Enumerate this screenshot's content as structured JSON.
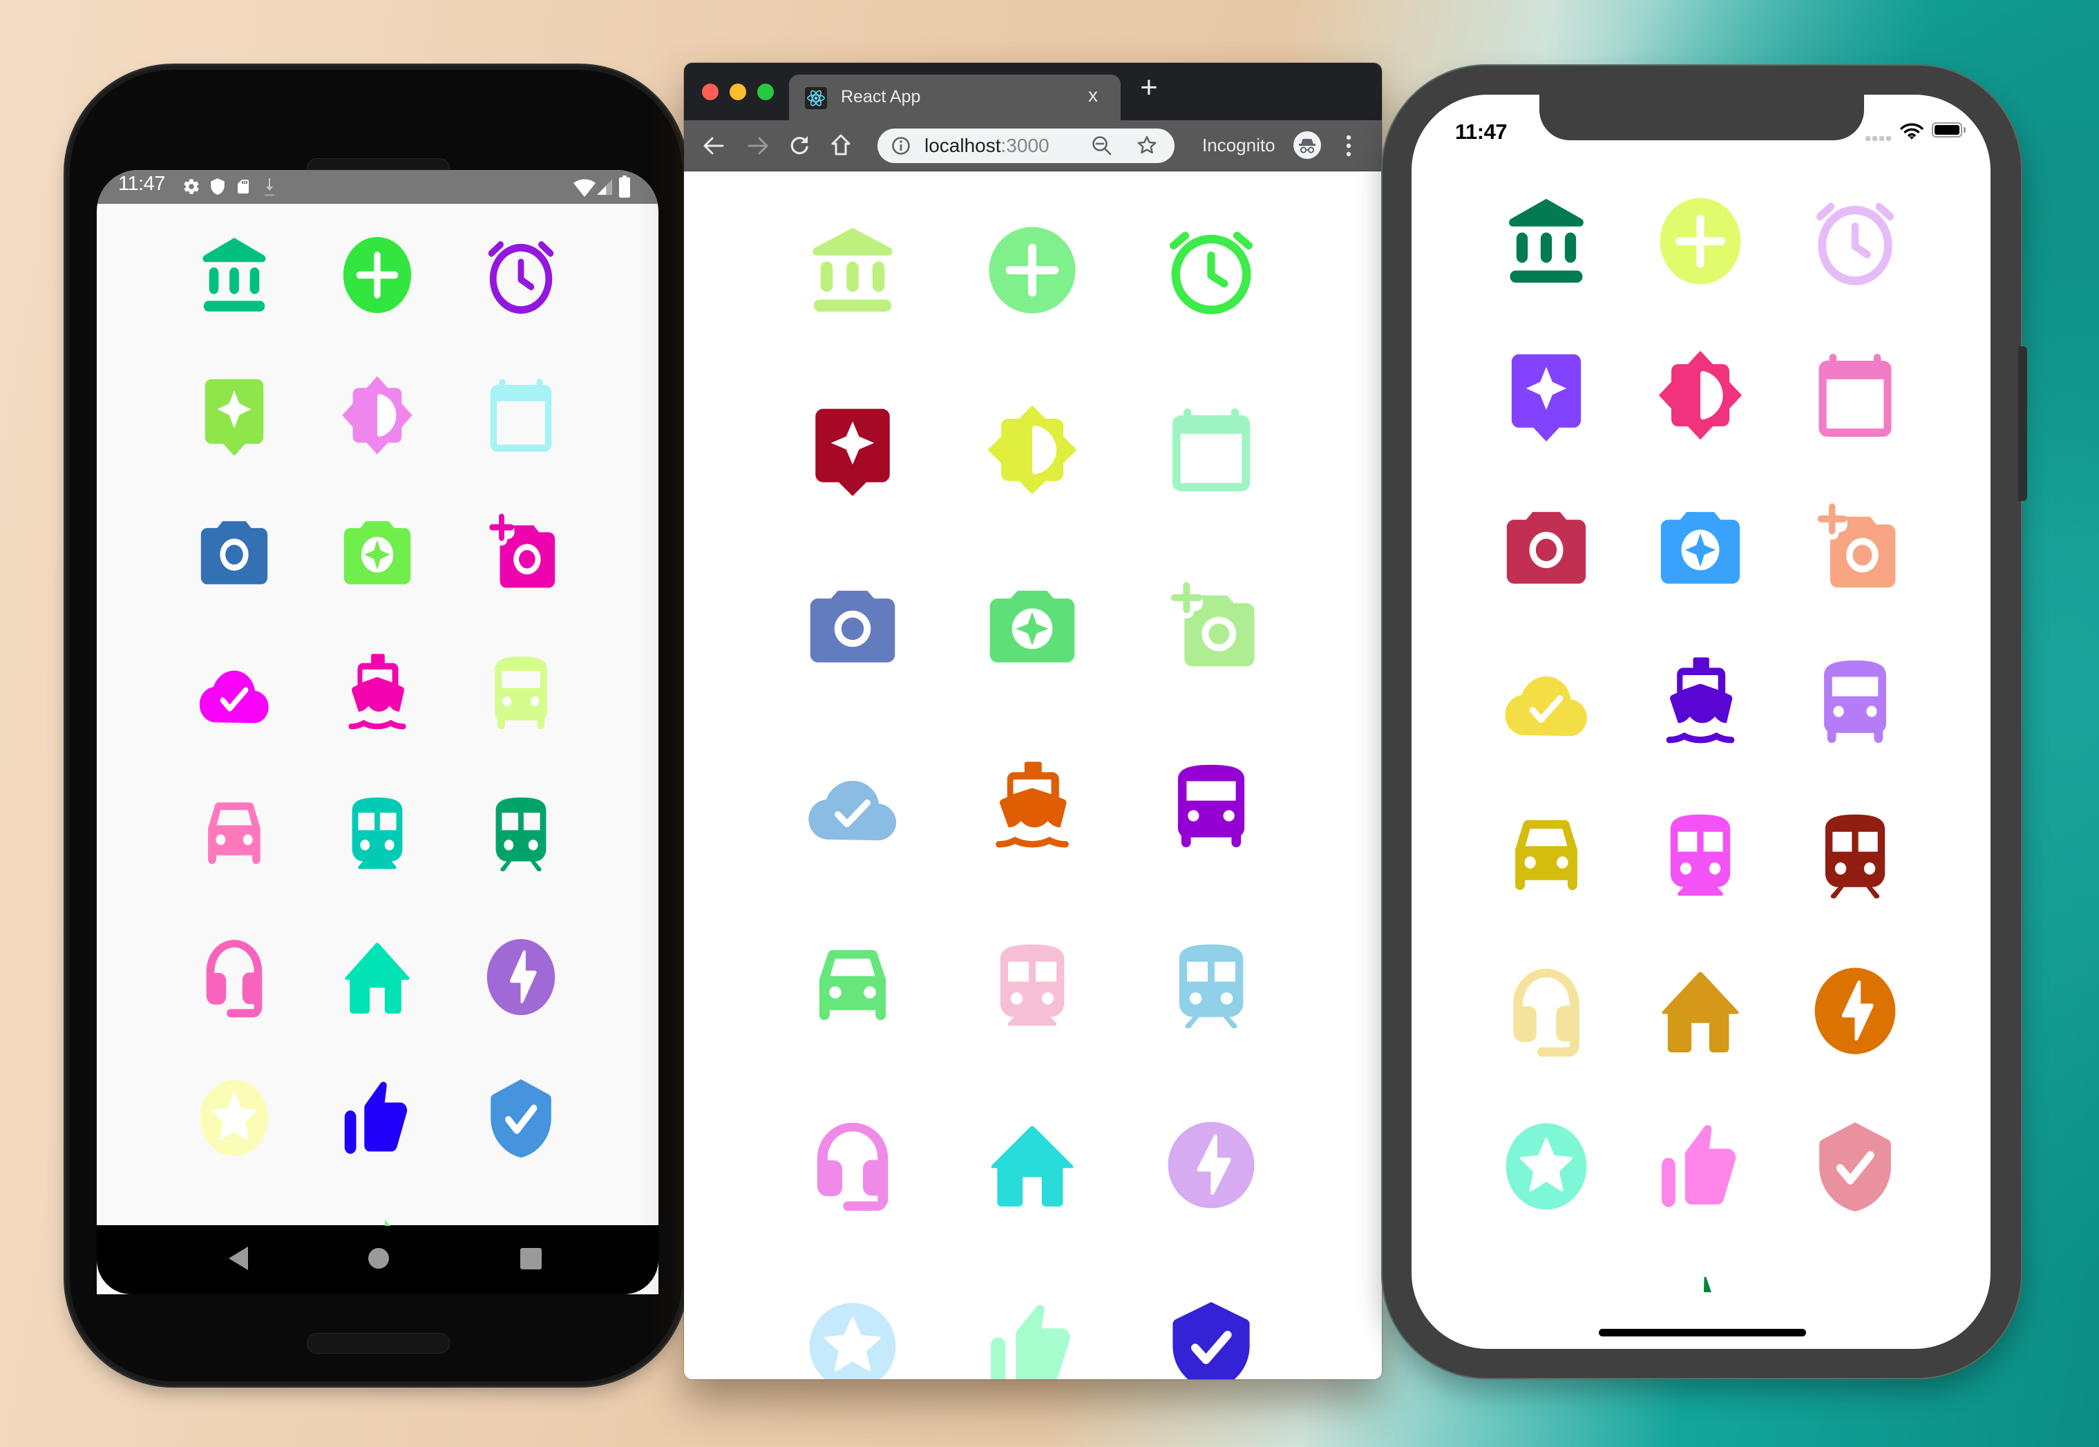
{
  "android": {
    "status_time": "11:47",
    "status_icons_left": [
      "settings-icon",
      "shield-icon",
      "sd-card-icon",
      "download-icon"
    ],
    "status_icons_right": [
      "wifi-icon",
      "cell-signal-icon",
      "battery-icon"
    ],
    "nav_buttons": [
      "back",
      "home",
      "recents"
    ],
    "background": "#f9f9f9",
    "icons": [
      {
        "name": "bank",
        "color": "#00c081"
      },
      {
        "name": "add-circle",
        "color": "#33e63f"
      },
      {
        "name": "alarm",
        "color": "#9318dd"
      },
      {
        "name": "sparkle-bubble",
        "color": "#8ee64b"
      },
      {
        "name": "brightness",
        "color": "#ee86ee"
      },
      {
        "name": "calendar",
        "color": "#a6f2f4"
      },
      {
        "name": "camera",
        "color": "#3370b4"
      },
      {
        "name": "camera-sparkle",
        "color": "#6fee4c"
      },
      {
        "name": "camera-add",
        "color": "#ee04ae"
      },
      {
        "name": "cloud-check",
        "color": "#f701f8"
      },
      {
        "name": "ferry",
        "color": "#f404ae"
      },
      {
        "name": "bus",
        "color": "#d4fd8c"
      },
      {
        "name": "car",
        "color": "#ff78be"
      },
      {
        "name": "train",
        "color": "#00ccb6"
      },
      {
        "name": "train-tracks",
        "color": "#00a46a"
      },
      {
        "name": "headset",
        "color": "#f863be"
      },
      {
        "name": "home",
        "color": "#01e3b4"
      },
      {
        "name": "flash-circle",
        "color": "#a169d5"
      },
      {
        "name": "star-circle",
        "color": "#fbfdb6"
      },
      {
        "name": "thumbs-up",
        "color": "#1f00f8"
      },
      {
        "name": "shield-check",
        "color": "#4594dd"
      }
    ]
  },
  "browser": {
    "tab_title": "React App",
    "tab_favicon": "react-logo-icon",
    "new_tab_label": "+",
    "close_tab_label": "x",
    "url_host": "localhost",
    "url_port": ":3000",
    "incognito_label": "Incognito",
    "traffic_lights": {
      "close": "#ff5f57",
      "minimize": "#febc2e",
      "maximize": "#28c840"
    },
    "icons": [
      {
        "name": "bank",
        "color": "#bef07d"
      },
      {
        "name": "add-circle",
        "color": "#7ff08b"
      },
      {
        "name": "alarm",
        "color": "#3deb4b"
      },
      {
        "name": "sparkle-bubble",
        "color": "#a50925"
      },
      {
        "name": "brightness",
        "color": "#e0ee3d"
      },
      {
        "name": "calendar",
        "color": "#9ff4c3"
      },
      {
        "name": "camera",
        "color": "#637cbe"
      },
      {
        "name": "camera-sparkle",
        "color": "#5fdf78"
      },
      {
        "name": "camera-add",
        "color": "#aeed92"
      },
      {
        "name": "cloud-check",
        "color": "#8bbce3"
      },
      {
        "name": "ferry",
        "color": "#e05d02"
      },
      {
        "name": "bus",
        "color": "#9400d4"
      },
      {
        "name": "car",
        "color": "#66e67b"
      },
      {
        "name": "train",
        "color": "#f7bfd5"
      },
      {
        "name": "train-tracks",
        "color": "#90d0e8"
      },
      {
        "name": "headset",
        "color": "#f08ae9"
      },
      {
        "name": "home",
        "color": "#28dcda"
      },
      {
        "name": "flash-circle",
        "color": "#d7abf2"
      },
      {
        "name": "star-circle",
        "color": "#c5eafb"
      },
      {
        "name": "thumbs-up",
        "color": "#a6fdcd"
      },
      {
        "name": "shield-check",
        "color": "#3322d6"
      }
    ]
  },
  "iphone": {
    "status_time": "11:47",
    "status_icons_right": [
      "cell-signal-icon",
      "wifi-icon",
      "battery-icon"
    ],
    "icons": [
      {
        "name": "bank",
        "color": "#027a52"
      },
      {
        "name": "add-circle",
        "color": "#e0fb6c"
      },
      {
        "name": "alarm",
        "color": "#e5bcf8"
      },
      {
        "name": "sparkle-bubble",
        "color": "#8342fe"
      },
      {
        "name": "brightness",
        "color": "#f1327c"
      },
      {
        "name": "calendar",
        "color": "#f27cc5"
      },
      {
        "name": "camera",
        "color": "#c13053"
      },
      {
        "name": "camera-sparkle",
        "color": "#39a2fd"
      },
      {
        "name": "camera-add",
        "color": "#f7a583"
      },
      {
        "name": "cloud-check",
        "color": "#f4de45"
      },
      {
        "name": "ferry",
        "color": "#5906d4"
      },
      {
        "name": "bus",
        "color": "#b57cf8"
      },
      {
        "name": "car",
        "color": "#d4bd0d"
      },
      {
        "name": "train",
        "color": "#f352f7"
      },
      {
        "name": "train-tracks",
        "color": "#911e10"
      },
      {
        "name": "headset",
        "color": "#f5e39d"
      },
      {
        "name": "home",
        "color": "#d49919"
      },
      {
        "name": "flash-circle",
        "color": "#dc7200"
      },
      {
        "name": "star-circle",
        "color": "#7ef7d6"
      },
      {
        "name": "thumbs-up",
        "color": "#fe85ea"
      },
      {
        "name": "shield-check",
        "color": "#ea919f"
      }
    ]
  },
  "loading_indicator_color": "#00843d"
}
